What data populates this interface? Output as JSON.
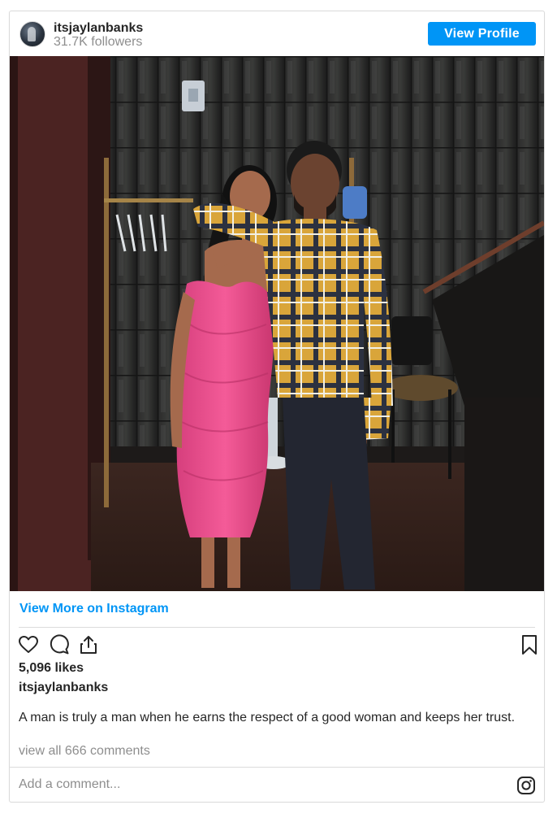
{
  "header": {
    "username": "itsjaylanbanks",
    "followers": "31.7K followers",
    "view_profile_label": "View Profile",
    "avatar_icon": "profile-photo"
  },
  "post": {
    "image_alt": "Photo",
    "view_more_label": "View More on Instagram"
  },
  "actions": {
    "like_icon": "heart-icon",
    "comment_icon": "comment-icon",
    "share_icon": "share-icon",
    "save_icon": "bookmark-icon"
  },
  "stats": {
    "likes": "5,096 likes"
  },
  "caption": {
    "username": "itsjaylanbanks",
    "text": "A man is truly a man when he earns the respect of a good woman and keeps her trust."
  },
  "comments": {
    "view_all_label": "view all 666 comments",
    "add_placeholder": "Add a comment...",
    "instagram_icon": "instagram-icon"
  },
  "colors": {
    "accent": "#0095f6",
    "text": "#262626",
    "muted": "#8e8e8e",
    "border": "#dbdbdb"
  }
}
